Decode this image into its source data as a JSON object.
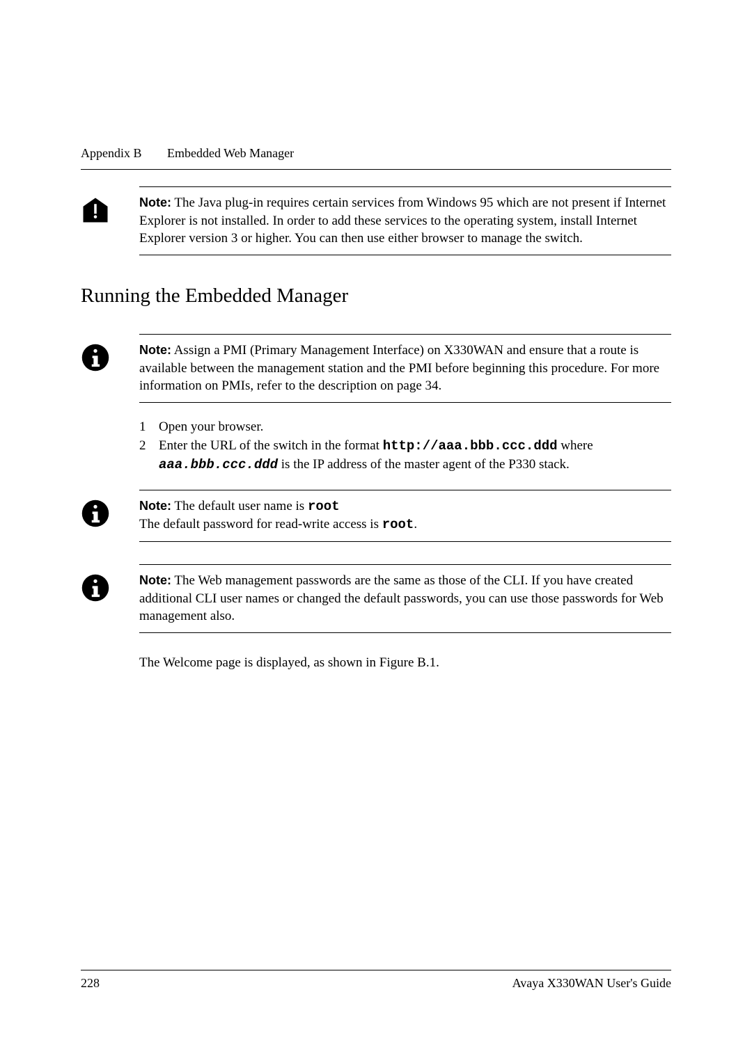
{
  "header": {
    "appendix": "Appendix B",
    "title": "Embedded Web Manager"
  },
  "notes": {
    "note1": {
      "label": "Note:",
      "text": "The Java plug-in requires certain services from Windows 95 which are not present if Internet Explorer is not installed. In order to add these services to the operating system, install Internet Explorer version 3 or higher. You can then use either browser to manage the switch."
    },
    "note2": {
      "label": "Note:",
      "text": "Assign a PMI (Primary Management Interface) on X330WAN and ensure that a route is available between the management station and the PMI before beginning this procedure. For more information on PMIs, refer to the description on page 34."
    },
    "note3": {
      "label": "Note:",
      "line1a": "The default user name is ",
      "line1b": "root",
      "line2a": "The default password for read-write access is ",
      "line2b": "root",
      "line2c": "."
    },
    "note4": {
      "label": "Note:",
      "text": "The Web management passwords are the same as those of the CLI. If you have created additional CLI user names or changed the default passwords, you can use those passwords for Web management also."
    }
  },
  "heading": "Running the Embedded Manager",
  "steps": {
    "s1": {
      "num": "1",
      "text": "Open your browser."
    },
    "s2": {
      "num": "2",
      "part1": "Enter the URL of the switch in the format ",
      "url": "http://aaa.bbb.ccc.ddd",
      "part2": " where ",
      "ip": "aaa.bbb.ccc.ddd",
      "part3": " is the IP address of the master agent of the P330 stack."
    }
  },
  "closing": "The Welcome page is displayed, as shown in Figure B.1.",
  "footer": {
    "page": "228",
    "guide": "Avaya X330WAN User's Guide"
  }
}
